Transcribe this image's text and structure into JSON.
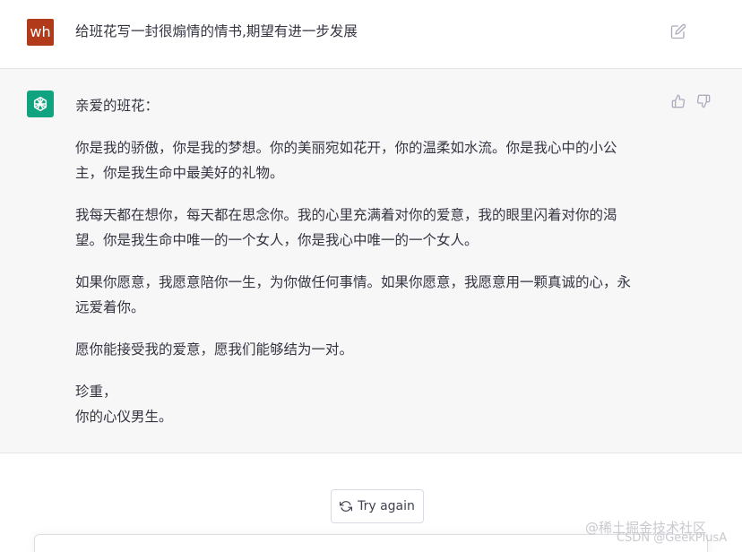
{
  "user_message": {
    "avatar_initials": "wh",
    "text": "给班花写一封很煽情的情书,期望有进一步发展"
  },
  "assistant_message": {
    "greeting": "亲爱的班花：",
    "paragraphs": [
      [
        "你是我的骄傲，你是我的梦想。你的美丽宛如花开，你的温柔如水流。你是我心中的小公",
        "主，你是我生命中最美好的礼物。"
      ],
      [
        "我每天都在想你，每天都在思念你。我的心里充满着对你的爱意，我的眼里闪着对你的渴",
        "望。你是我生命中唯一的一个女人，你是我心中唯一的一个女人。"
      ],
      [
        "如果你愿意，我愿意陪你一生，为你做任何事情。如果你愿意，我愿意用一颗真诚的心，永",
        "远爱着你。"
      ],
      [
        "愿你能接受我的爱意，愿我们能够结为一对。"
      ],
      [
        "珍重，",
        "你的心仪男生。"
      ]
    ]
  },
  "actions": {
    "try_again_label": "Try again"
  },
  "watermark": {
    "line1": "@稀土掘金技术社区",
    "line2": "CSDN @GeekPlusA"
  },
  "colors": {
    "user_avatar": "#b13a1a",
    "assistant_avatar": "#10a37f",
    "assistant_bg": "#f7f7f8"
  }
}
